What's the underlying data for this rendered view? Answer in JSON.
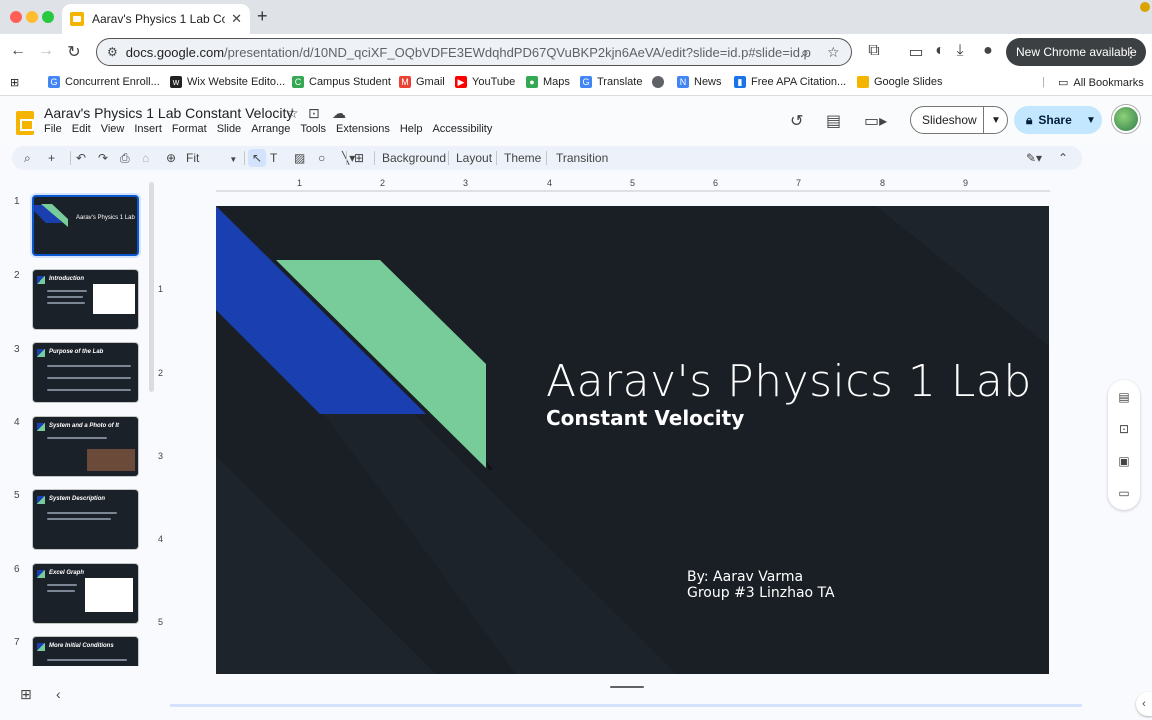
{
  "browser": {
    "tab_title": "Aarav's Physics 1 Lab Consta",
    "url_host": "docs.google.com",
    "url_path": "/presentation/d/10ND_qciXF_OQbVDFE3EWdqhdPD67QVuBKP2kjn6AeVA/edit?slide=id.p#slide=id.p",
    "chrome_available": "New Chrome available",
    "bookmarks": [
      {
        "label": "Concurrent Enroll...",
        "color": "#4285f4"
      },
      {
        "label": "Wix Website Edito...",
        "color": "#222222"
      },
      {
        "label": "Campus Student",
        "color": "#34a853"
      },
      {
        "label": "Gmail",
        "color": "#ea4335"
      },
      {
        "label": "YouTube",
        "color": "#ff0000"
      },
      {
        "label": "Maps",
        "color": "#34a853"
      },
      {
        "label": "Translate",
        "color": "#4285f4"
      },
      {
        "label": "",
        "color": "#5f6368"
      },
      {
        "label": "News",
        "color": "#4285f4"
      },
      {
        "label": "Free APA Citation...",
        "color": "#1a73e8"
      },
      {
        "label": "Google Slides",
        "color": "#f4b400"
      }
    ],
    "all_bookmarks": "All Bookmarks"
  },
  "docs": {
    "title": "Aarav's Physics 1 Lab  Constant Velocity",
    "menu": [
      "File",
      "Edit",
      "View",
      "Insert",
      "Format",
      "Slide",
      "Arrange",
      "Tools",
      "Extensions",
      "Help",
      "Accessibility"
    ],
    "slideshow_label": "Slideshow",
    "share_label": "Share"
  },
  "toolbar": {
    "zoom": "Fit",
    "background": "Background",
    "layout": "Layout",
    "theme": "Theme",
    "transition": "Transition"
  },
  "ruler": {
    "h_ticks": [
      "1",
      "2",
      "3",
      "4",
      "5",
      "6",
      "7",
      "8",
      "9"
    ],
    "v_ticks": [
      "1",
      "2",
      "3",
      "4",
      "5"
    ]
  },
  "filmstrip": [
    {
      "num": "1",
      "title": "Aarav's Physics 1 Lab"
    },
    {
      "num": "2",
      "title": "Introduction"
    },
    {
      "num": "3",
      "title": "Purpose of the Lab"
    },
    {
      "num": "4",
      "title": "System and a Photo of It"
    },
    {
      "num": "5",
      "title": "System Description"
    },
    {
      "num": "6",
      "title": "Excel Graph"
    },
    {
      "num": "7",
      "title": "More Initial Conditions"
    }
  ],
  "slide": {
    "title": "Aarav's Physics 1 Lab",
    "subtitle": "Constant Velocity",
    "byline_1": "By: Aarav Varma",
    "byline_2": "Group #3 Linzhao TA",
    "colors": {
      "background": "#1a1f26",
      "blue": "#1a3fb0",
      "green": "#77cc99"
    }
  }
}
